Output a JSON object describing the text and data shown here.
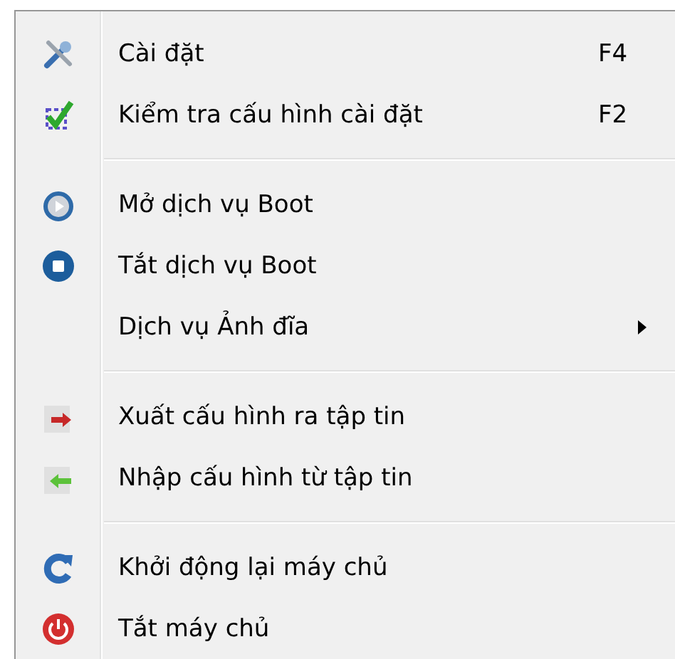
{
  "menu": {
    "groups": [
      {
        "items": [
          {
            "label": "Cài đặt",
            "shortcut": "F4",
            "submenu": false
          },
          {
            "label": "Kiểm tra cấu hình cài đặt",
            "shortcut": "F2",
            "submenu": false
          }
        ]
      },
      {
        "items": [
          {
            "label": "Mở dịch vụ Boot",
            "submenu": false
          },
          {
            "label": "Tắt dịch vụ Boot",
            "submenu": false
          },
          {
            "label": "Dịch vụ Ảnh đĩa",
            "submenu": true
          }
        ]
      },
      {
        "items": [
          {
            "label": "Xuất cấu hình ra tập tin",
            "submenu": false
          },
          {
            "label": "Nhập cấu hình từ tập tin",
            "submenu": false
          }
        ]
      },
      {
        "items": [
          {
            "label": "Khởi động lại máy chủ",
            "submenu": false
          },
          {
            "label": "Tắt máy chủ",
            "submenu": false
          }
        ]
      }
    ]
  }
}
